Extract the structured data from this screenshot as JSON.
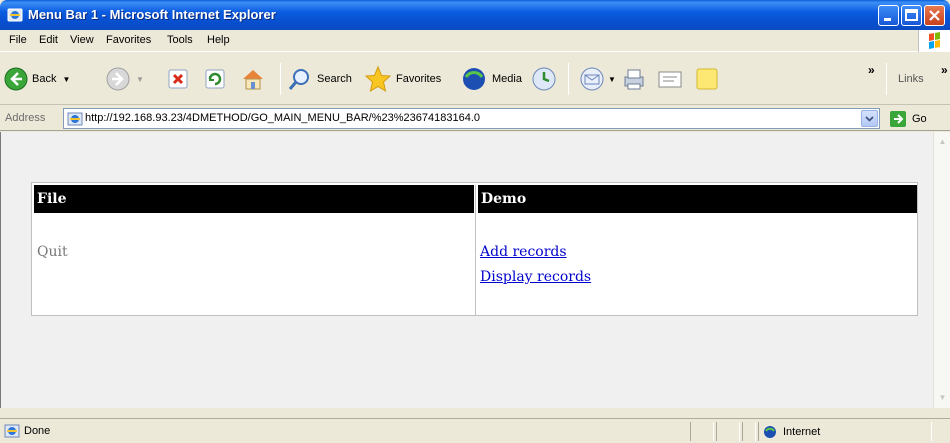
{
  "window": {
    "title": "Menu Bar 1 - Microsoft Internet Explorer"
  },
  "menubar": {
    "items": [
      "File",
      "Edit",
      "View",
      "Favorites",
      "Tools",
      "Help"
    ]
  },
  "toolbar": {
    "back_label": "Back",
    "search_label": "Search",
    "favorites_label": "Favorites",
    "media_label": "Media",
    "links_label": "Links",
    "overflow_label": "»"
  },
  "address": {
    "label": "Address",
    "url": "http://192.168.93.23/4DMETHOD/GO_MAIN_MENU_BAR/%23%23674183164.0",
    "go_label": "Go"
  },
  "page": {
    "columns": [
      {
        "header": "File",
        "items": [
          "Quit"
        ]
      },
      {
        "header": "Demo",
        "items": [
          "Add records",
          "Display records"
        ]
      }
    ]
  },
  "status": {
    "text": "Done",
    "zone": "Internet"
  },
  "colors": {
    "titlebar": "#0a5fd8",
    "link": "#0000cc",
    "header_bg": "#000000"
  }
}
